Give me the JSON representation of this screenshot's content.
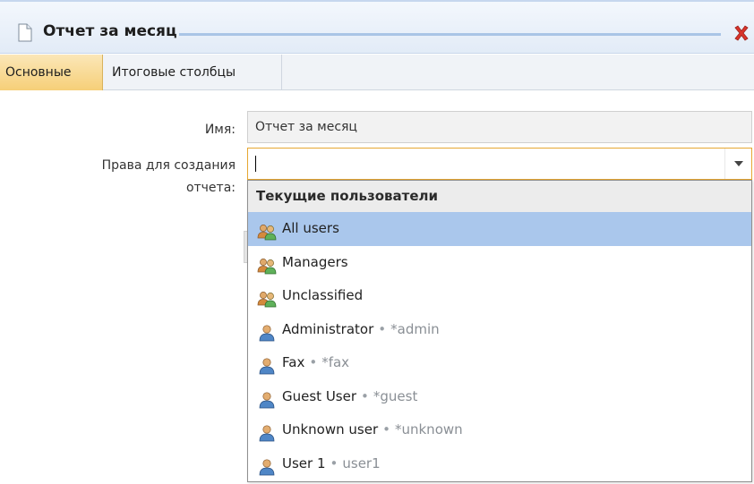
{
  "window": {
    "title": "Отчет за месяц"
  },
  "tabs": [
    {
      "label": "Основные",
      "active": true
    },
    {
      "label": "Итоговые столбцы",
      "active": false
    }
  ],
  "form": {
    "name_label": "Имя:",
    "name_value": "Отчет за месяц",
    "rights_label_line1": "Права для создания",
    "rights_label_line2": "отчета:",
    "rights_value": ""
  },
  "dropdown": {
    "header": "Текущие пользователи",
    "items": [
      {
        "name": "All users",
        "login": "",
        "type": "group",
        "selected": true
      },
      {
        "name": "Managers",
        "login": "",
        "type": "group",
        "selected": false
      },
      {
        "name": "Unclassified",
        "login": "",
        "type": "group",
        "selected": false
      },
      {
        "name": "Administrator",
        "login": "*admin",
        "type": "user",
        "selected": false
      },
      {
        "name": "Fax",
        "login": "*fax",
        "type": "user",
        "selected": false
      },
      {
        "name": "Guest User",
        "login": "*guest",
        "type": "user",
        "selected": false
      },
      {
        "name": "Unknown user",
        "login": "*unknown",
        "type": "user",
        "selected": false
      },
      {
        "name": "User 1",
        "login": "user1",
        "type": "user",
        "selected": false
      }
    ],
    "separator": "•"
  },
  "icons": {
    "title": "document-icon",
    "close": "close-icon",
    "combo_arrow": "chevron-down-icon",
    "group": "user-group-icon",
    "user": "user-icon"
  },
  "colors": {
    "active_tab": "#f6cf78",
    "selected_row": "#aac7ec",
    "focus_border": "#e6a732",
    "close": "#d9342b"
  }
}
